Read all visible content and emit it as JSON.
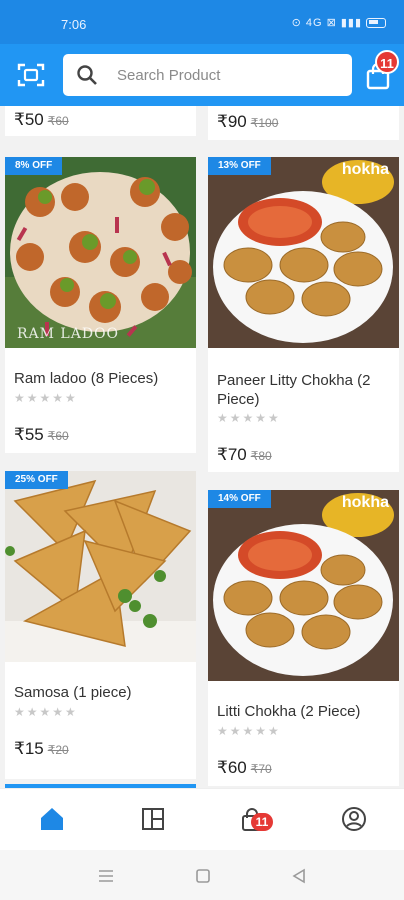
{
  "status_bar": {
    "time": "7:06",
    "icons": "⊙ 4G ⊠ ▮▮▮"
  },
  "header": {
    "search_placeholder": "Search Product",
    "cart_count": "11"
  },
  "top_row": [
    {
      "price": "₹50",
      "mrp": "₹60"
    },
    {
      "price": "₹90",
      "mrp": "₹100"
    }
  ],
  "products": [
    {
      "name": "Ram ladoo (8 Pieces)",
      "discount": "8% OFF",
      "price": "₹55",
      "mrp": "₹60",
      "rating": 0,
      "image_text": "RAM LADOO"
    },
    {
      "name": "Paneer Litty Chokha (2 Piece)",
      "discount": "13% OFF",
      "price": "₹70",
      "mrp": "₹80",
      "rating": 0,
      "image_text": "hokha"
    },
    {
      "name": "Samosa (1 piece)",
      "discount": "25% OFF",
      "price": "₹15",
      "mrp": "₹20",
      "rating": 0
    },
    {
      "name": "Litti Chokha (2 Piece)",
      "discount": "14% OFF",
      "price": "₹60",
      "mrp": "₹70",
      "rating": 0,
      "image_text": "hokha"
    }
  ],
  "bottom_nav": {
    "items": [
      "home-icon",
      "categories-icon",
      "cart-icon",
      "account-icon"
    ],
    "cart_badge": "11",
    "active_color": "#1e88e5"
  },
  "colors": {
    "brand": "#2196f3",
    "badge": "#e53935"
  }
}
